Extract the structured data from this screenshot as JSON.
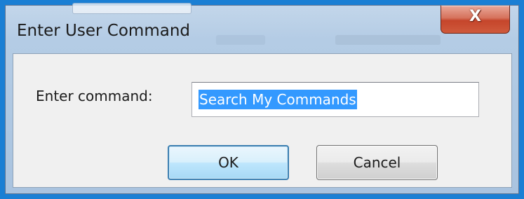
{
  "window": {
    "title": "Enter User Command",
    "close_glyph": "X"
  },
  "form": {
    "command_label": "Enter command:",
    "command_value": "Search My Commands"
  },
  "buttons": {
    "ok_label": "OK",
    "cancel_label": "Cancel"
  },
  "colors": {
    "highlight_border": "#1a7fd4",
    "selection": "#3399ff",
    "close_button": "#c5452b",
    "default_button_border": "#3c7fb1"
  }
}
